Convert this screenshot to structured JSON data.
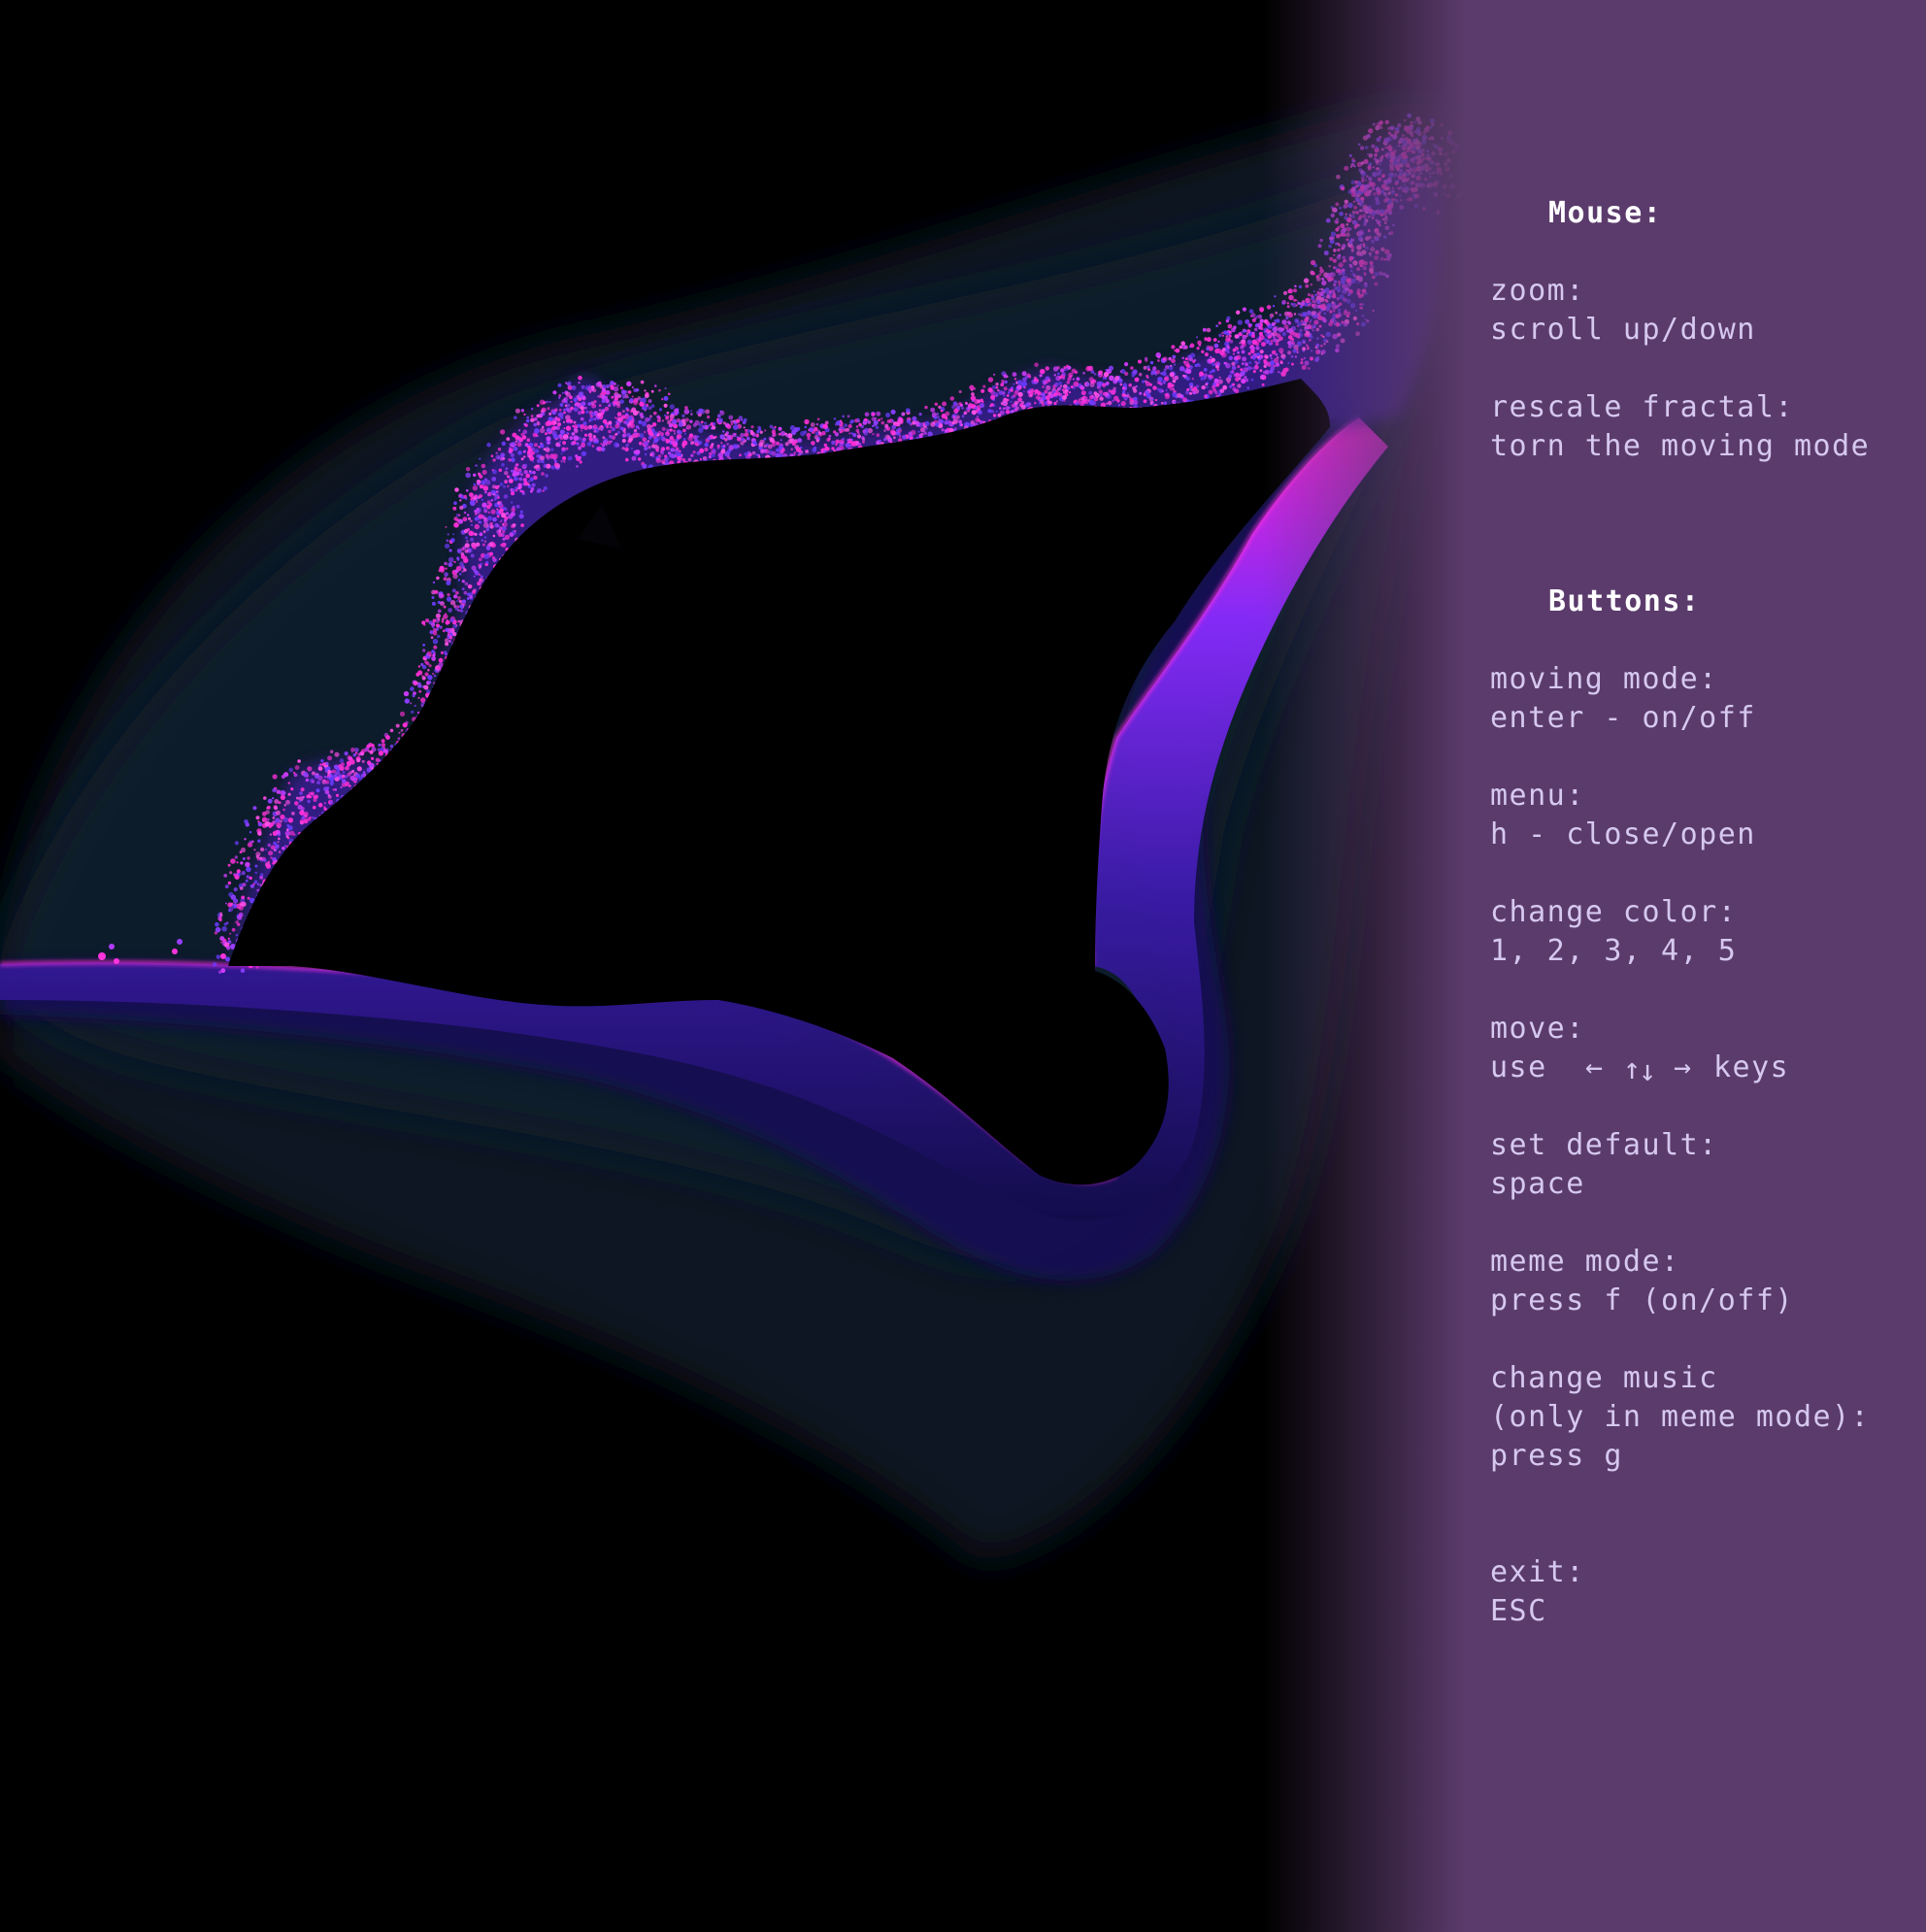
{
  "app": {
    "view": "fractal explorer"
  },
  "colors": {
    "background": "#000000",
    "menu_panel": "#5b3b6c",
    "menu_text": "#d6c8ef",
    "heading_text": "#ffffff",
    "fractal_edge": "#ff1fd6",
    "fractal_glow": "#6a2cff",
    "fractal_halo": "#0a1b25"
  },
  "menu": {
    "mouse_heading": "Mouse:",
    "zoom_label": "zoom:",
    "zoom_value": "scroll up/down",
    "rescale_label": "rescale fractal:",
    "rescale_value": "torn the moving mode",
    "buttons_heading": "Buttons:",
    "moving_label": "moving mode:",
    "moving_value": "enter - on/off",
    "menu_label": "menu:",
    "menu_value": "h - close/open",
    "color_label": "change color:",
    "color_value": "1, 2, 3, 4, 5",
    "move_label": "move:",
    "move_use": "use",
    "move_keys": "keys",
    "move_arrows": {
      "left": "←",
      "up": "↑",
      "down": "↓",
      "right": "→"
    },
    "default_label": "set default:",
    "default_value": "space",
    "meme_label": "meme mode:",
    "meme_value": "press f (on/off)",
    "music_label_1": "change music",
    "music_label_2": "(only in meme mode):",
    "music_value": "press g",
    "exit_label": "exit:",
    "exit_value": "ESC"
  }
}
